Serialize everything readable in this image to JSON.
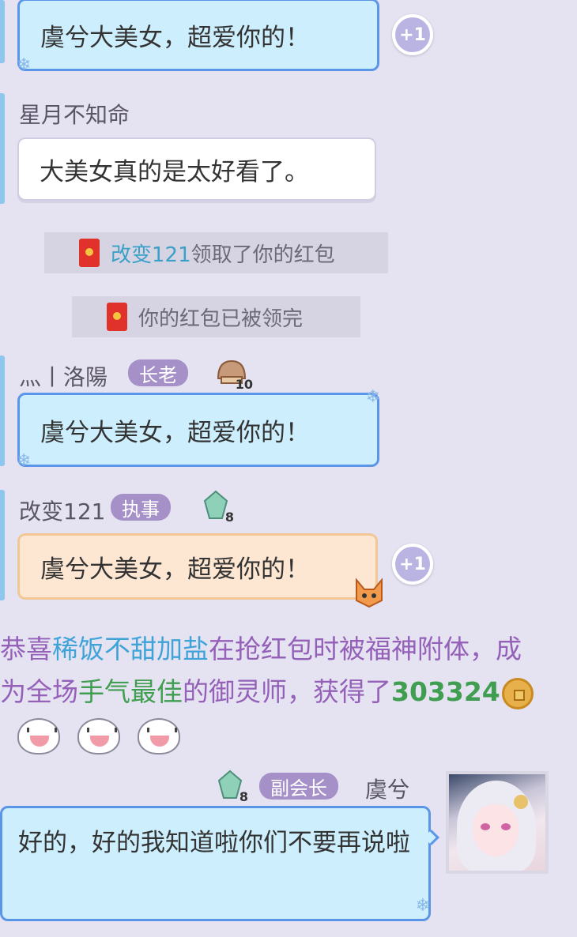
{
  "messages": {
    "m1": {
      "text": "虞兮大美女，超爱你的！",
      "plus": "+1"
    },
    "m2": {
      "sender": "星月不知命",
      "text": "大美女真的是太好看了。"
    },
    "m3": {
      "sender": "灬丨洛陽",
      "role": "长老",
      "level": "10",
      "text": "虞兮大美女，超爱你的！"
    },
    "m4": {
      "sender": "改变121",
      "role": "执事",
      "level": "8",
      "text": "虞兮大美女，超爱你的！",
      "plus": "+1"
    },
    "m5": {
      "sender": "虞兮",
      "role": "副会长",
      "level": "8",
      "text": "好的，好的我知道啦你们不要再说啦"
    }
  },
  "system": {
    "s1": {
      "user": "改变121",
      "text": "领取了你的红包"
    },
    "s2": {
      "text": "你的红包已被领完"
    }
  },
  "announcement": {
    "part1": "恭喜",
    "user": "稀饭不甜加盐",
    "part2": "在抢红包时被福神附体，成为全场",
    "highlight": "手气最佳",
    "part3": "的御灵师，获得了",
    "amount": "303324"
  },
  "colors": {
    "background": "#e5e3f2",
    "bubble_blue": "#cdeefc",
    "bubble_border": "#5b95e8",
    "badge": "#a590c8",
    "announce": "#9460b8"
  }
}
